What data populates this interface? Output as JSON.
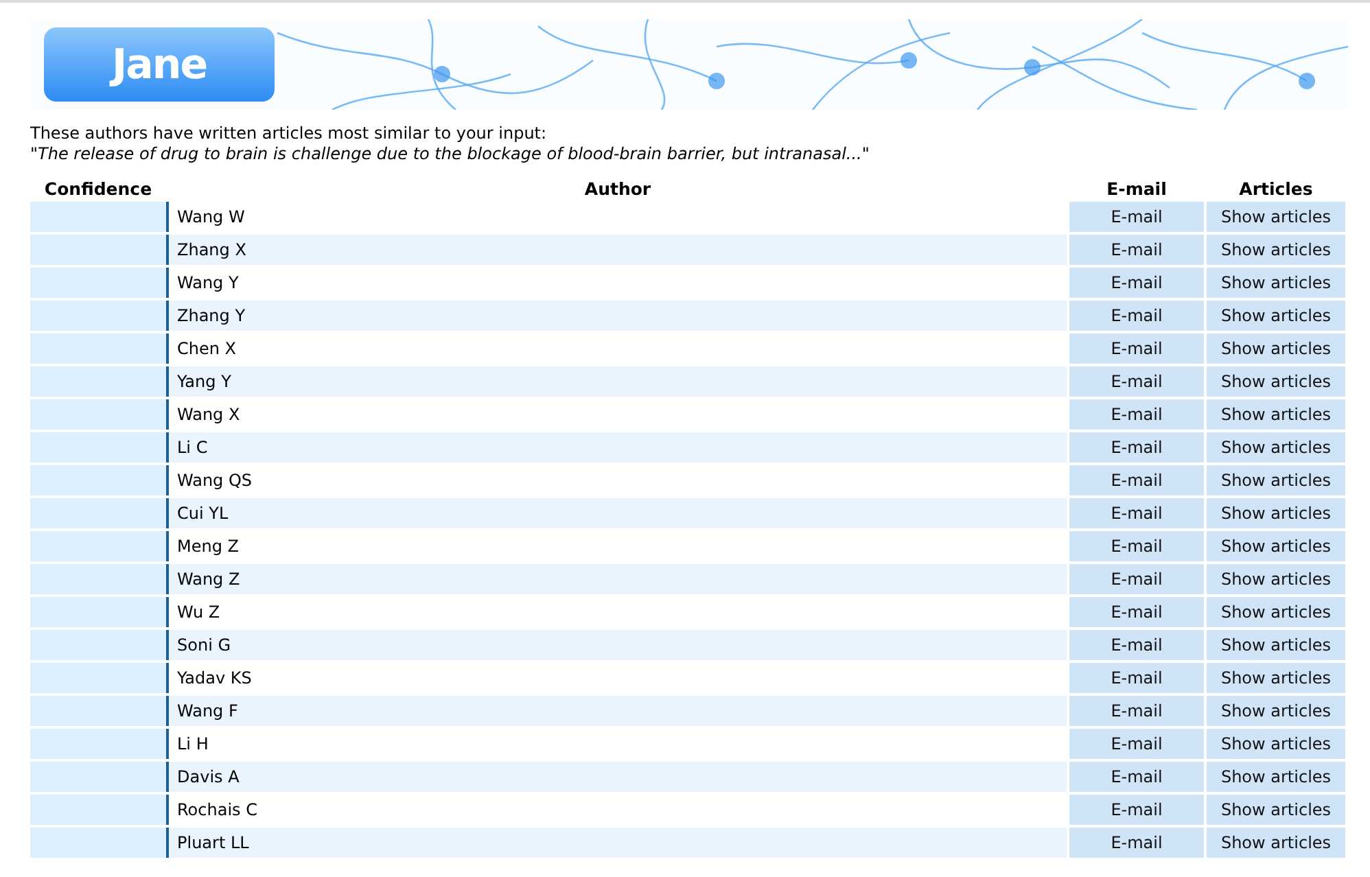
{
  "logo": {
    "text": "Jane"
  },
  "intro": {
    "text": "These authors have written articles most similar to your input:",
    "query": "\"The release of drug to brain is challenge due to the blockage of blood-brain barrier, but intranasal...\""
  },
  "table": {
    "columns": [
      "Confidence",
      "Author",
      "E-mail",
      "Articles"
    ],
    "rows": [
      {
        "author": "Wang W",
        "email": "E-mail",
        "articles": "Show articles"
      },
      {
        "author": "Zhang X",
        "email": "E-mail",
        "articles": "Show articles"
      },
      {
        "author": "Wang Y",
        "email": "E-mail",
        "articles": "Show articles"
      },
      {
        "author": "Zhang Y",
        "email": "E-mail",
        "articles": "Show articles"
      },
      {
        "author": "Chen X",
        "email": "E-mail",
        "articles": "Show articles"
      },
      {
        "author": "Yang Y",
        "email": "E-mail",
        "articles": "Show articles"
      },
      {
        "author": "Wang X",
        "email": "E-mail",
        "articles": "Show articles"
      },
      {
        "author": "Li C",
        "email": "E-mail",
        "articles": "Show articles"
      },
      {
        "author": "Wang QS",
        "email": "E-mail",
        "articles": "Show articles"
      },
      {
        "author": "Cui YL",
        "email": "E-mail",
        "articles": "Show articles"
      },
      {
        "author": "Meng Z",
        "email": "E-mail",
        "articles": "Show articles"
      },
      {
        "author": "Wang Z",
        "email": "E-mail",
        "articles": "Show articles"
      },
      {
        "author": "Wu Z",
        "email": "E-mail",
        "articles": "Show articles"
      },
      {
        "author": "Soni G",
        "email": "E-mail",
        "articles": "Show articles"
      },
      {
        "author": "Yadav KS",
        "email": "E-mail",
        "articles": "Show articles"
      },
      {
        "author": "Wang F",
        "email": "E-mail",
        "articles": "Show articles"
      },
      {
        "author": "Li H",
        "email": "E-mail",
        "articles": "Show articles"
      },
      {
        "author": "Davis A",
        "email": "E-mail",
        "articles": "Show articles"
      },
      {
        "author": "Rochais C",
        "email": "E-mail",
        "articles": "Show articles"
      },
      {
        "author": "Pluart LL",
        "email": "E-mail",
        "articles": "Show articles"
      }
    ]
  }
}
